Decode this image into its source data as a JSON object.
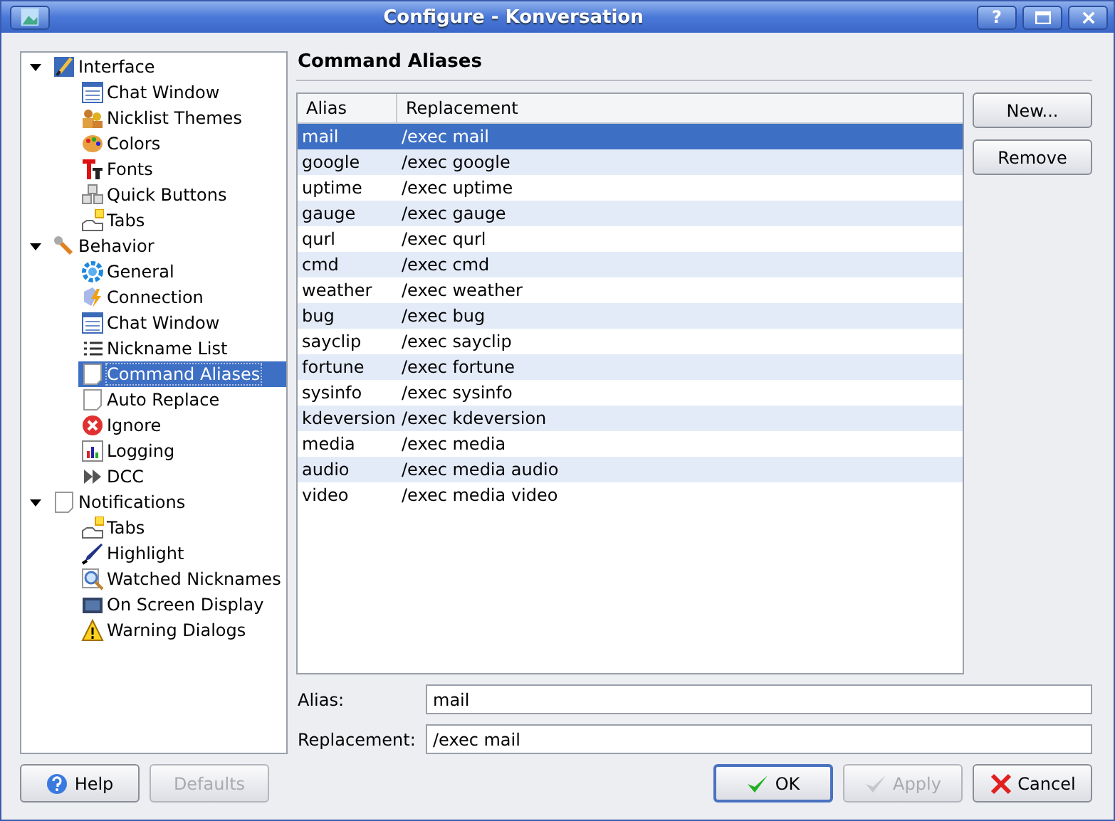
{
  "window": {
    "title": "Configure - Konversation",
    "buttons": [
      "?"
    ]
  },
  "tree": [
    {
      "label": "Interface",
      "expanded": true,
      "selected": false,
      "children": [
        {
          "label": "Chat Window",
          "selected": false
        },
        {
          "label": "Nicklist Themes",
          "selected": false
        },
        {
          "label": "Colors",
          "selected": false
        },
        {
          "label": "Fonts",
          "selected": false
        },
        {
          "label": "Quick Buttons",
          "selected": false
        },
        {
          "label": "Tabs",
          "selected": false
        }
      ]
    },
    {
      "label": "Behavior",
      "expanded": true,
      "selected": false,
      "children": [
        {
          "label": "General",
          "selected": false
        },
        {
          "label": "Connection",
          "selected": false
        },
        {
          "label": "Chat Window",
          "selected": false
        },
        {
          "label": "Nickname List",
          "selected": false
        },
        {
          "label": "Command Aliases",
          "selected": true
        },
        {
          "label": "Auto Replace",
          "selected": false
        },
        {
          "label": "Ignore",
          "selected": false
        },
        {
          "label": "Logging",
          "selected": false
        },
        {
          "label": "DCC",
          "selected": false
        }
      ]
    },
    {
      "label": "Notifications",
      "expanded": true,
      "selected": false,
      "children": [
        {
          "label": "Tabs",
          "selected": false
        },
        {
          "label": "Highlight",
          "selected": false
        },
        {
          "label": "Watched Nicknames",
          "selected": false
        },
        {
          "label": "On Screen Display",
          "selected": false
        },
        {
          "label": "Warning Dialogs",
          "selected": false
        }
      ]
    }
  ],
  "page_title": "Command Aliases",
  "table": {
    "columns": [
      "Alias",
      "Replacement"
    ],
    "rows": [
      {
        "alias": "mail",
        "replacement": "/exec mail",
        "selected": true
      },
      {
        "alias": "google",
        "replacement": "/exec google",
        "selected": false
      },
      {
        "alias": "uptime",
        "replacement": "/exec uptime",
        "selected": false
      },
      {
        "alias": "gauge",
        "replacement": "/exec gauge",
        "selected": false
      },
      {
        "alias": "qurl",
        "replacement": "/exec qurl",
        "selected": false
      },
      {
        "alias": "cmd",
        "replacement": "/exec cmd",
        "selected": false
      },
      {
        "alias": "weather",
        "replacement": "/exec weather",
        "selected": false
      },
      {
        "alias": "bug",
        "replacement": "/exec bug",
        "selected": false
      },
      {
        "alias": "sayclip",
        "replacement": "/exec sayclip",
        "selected": false
      },
      {
        "alias": "fortune",
        "replacement": "/exec fortune",
        "selected": false
      },
      {
        "alias": "sysinfo",
        "replacement": "/exec sysinfo",
        "selected": false
      },
      {
        "alias": "kdeversion",
        "replacement": "/exec kdeversion",
        "selected": false
      },
      {
        "alias": "media",
        "replacement": "/exec media",
        "selected": false
      },
      {
        "alias": "audio",
        "replacement": "/exec media audio",
        "selected": false
      },
      {
        "alias": "video",
        "replacement": "/exec media video",
        "selected": false
      }
    ]
  },
  "side_buttons": [
    {
      "label": "New...",
      "disabled": false
    },
    {
      "label": "Remove",
      "disabled": false
    }
  ],
  "fields": [
    {
      "label": "Alias:",
      "value": "mail"
    },
    {
      "label": "Replacement:",
      "value": "/exec mail"
    }
  ],
  "footer_left": [
    {
      "label": "Help",
      "disabled": false,
      "kind": "help"
    },
    {
      "label": "Defaults",
      "disabled": true,
      "kind": "plain"
    }
  ],
  "footer_right": [
    {
      "label": "OK",
      "disabled": false,
      "kind": "ok",
      "default": true
    },
    {
      "label": "Apply",
      "disabled": true,
      "kind": "apply",
      "default": false
    },
    {
      "label": "Cancel",
      "disabled": false,
      "kind": "cancel",
      "default": false
    }
  ]
}
